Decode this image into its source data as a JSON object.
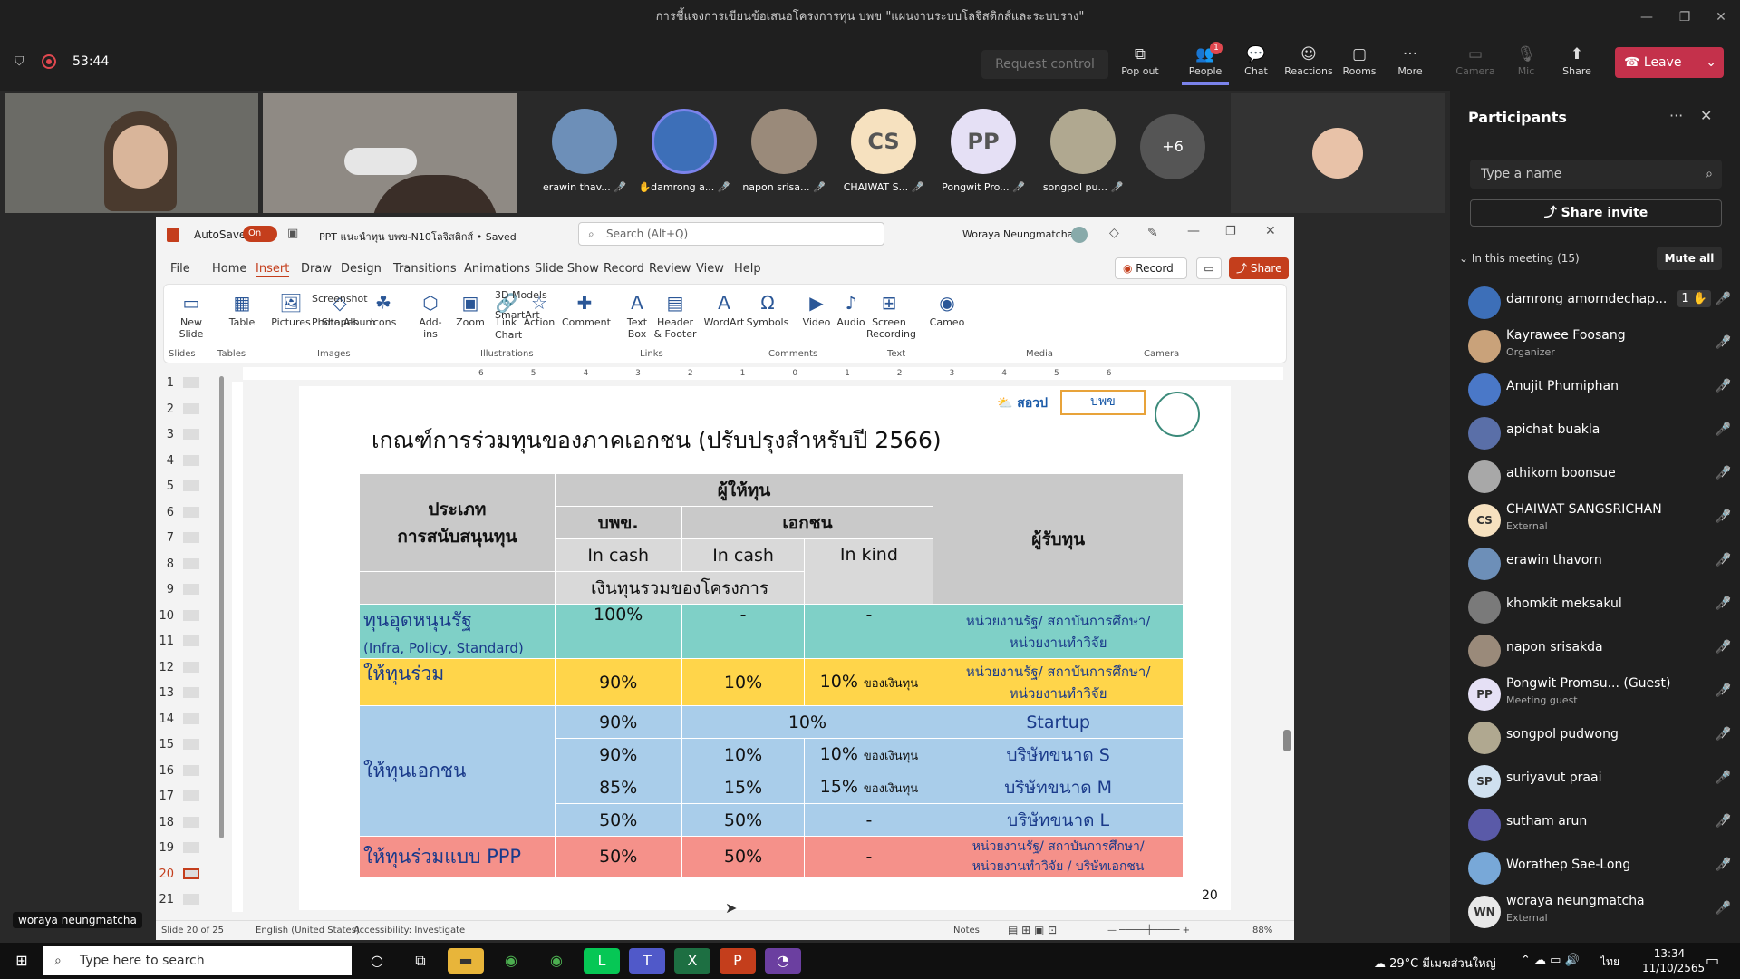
{
  "window": {
    "title": "การชี้แจงการเขียนข้อเสนอโครงการทุน บพข \"แผนงานระบบโลจิสติกส์และระบบราง\"",
    "min": "—",
    "max": "❐",
    "close": "✕"
  },
  "meeting": {
    "timer": "53:44",
    "request_control": "Request control",
    "buttons": [
      {
        "label": "Pop out",
        "icon": "popout-icon",
        "glyph": "⧉"
      },
      {
        "label": "People",
        "icon": "people-icon",
        "glyph": "👥",
        "badge": "1"
      },
      {
        "label": "Chat",
        "icon": "chat-icon",
        "glyph": "💬"
      },
      {
        "label": "Reactions",
        "icon": "reactions-icon",
        "glyph": "☺"
      },
      {
        "label": "Rooms",
        "icon": "rooms-icon",
        "glyph": "▢"
      },
      {
        "label": "More",
        "icon": "more-icon",
        "glyph": "···"
      }
    ],
    "camera": "Camera",
    "mic": "Mic",
    "share": "Share",
    "leave": "Leave"
  },
  "videos": {
    "presenter_label": "woraya neungmatcha",
    "avatars": [
      {
        "name": "erawin thav...",
        "initials": "",
        "color": "#6d8fb8"
      },
      {
        "name": "damrong a...",
        "initials": "",
        "color": "#3d6fb8",
        "hand": "✋"
      },
      {
        "name": "napon srisa...",
        "initials": "",
        "color": "#9a8a7a"
      },
      {
        "name": "CHAIWAT S...",
        "initials": "CS",
        "color": "#f6e1bf"
      },
      {
        "name": "Pongwit Pro...",
        "initials": "PP",
        "color": "#e5e0f5"
      },
      {
        "name": "songpol pu...",
        "initials": "",
        "color": "#b0a890"
      }
    ],
    "more_count": "+6"
  },
  "ppt": {
    "autosave": "AutoSave",
    "autosave_state": "On",
    "filename": "PPT แนะนำทุน บพข-N10โลจิสติกส์ • Saved",
    "search_placeholder": "Search (Alt+Q)",
    "user": "Woraya Neungmatcha",
    "record": "Record",
    "share": "Share",
    "tabs": [
      "File",
      "Home",
      "Insert",
      "Draw",
      "Design",
      "Transitions",
      "Animations",
      "Slide Show",
      "Record",
      "Review",
      "View",
      "Help"
    ],
    "ribbon": [
      {
        "label": "New\nSlide",
        "glyph": "▭"
      },
      {
        "label": "Table",
        "glyph": "▦"
      },
      {
        "label": "Pictures",
        "glyph": "🖼"
      },
      {
        "label": "Shapes",
        "glyph": "◇"
      },
      {
        "label": "Icons",
        "glyph": "☘"
      },
      {
        "label": "Add-\nins",
        "glyph": "⬡"
      },
      {
        "label": "Zoom",
        "glyph": "▣"
      },
      {
        "label": "Link",
        "glyph": "🔗"
      },
      {
        "label": "Action",
        "glyph": "☆"
      },
      {
        "label": "Comment",
        "glyph": "✚"
      },
      {
        "label": "Text\nBox",
        "glyph": "A"
      },
      {
        "label": "Header\n& Footer",
        "glyph": "▤"
      },
      {
        "label": "WordArt",
        "glyph": "A"
      },
      {
        "label": "Symbols",
        "glyph": "Ω"
      },
      {
        "label": "Video",
        "glyph": "▶"
      },
      {
        "label": "Audio",
        "glyph": "♪"
      },
      {
        "label": "Screen\nRecording",
        "glyph": "⊞"
      },
      {
        "label": "Cameo",
        "glyph": "◉"
      }
    ],
    "ribbon_small": [
      "Screenshot",
      "Photo Album",
      "3D Models",
      "SmartArt",
      "Chart"
    ],
    "groups": [
      "Slides",
      "Tables",
      "Images",
      "Illustrations",
      "Links",
      "Comments",
      "Text",
      "Media",
      "Camera"
    ],
    "status": {
      "slide": "Slide 20 of 25",
      "lang": "English (United States)",
      "access": "Accessibility: Investigate",
      "notes": "Notes",
      "zoom": "88%"
    },
    "thumbs": [
      "1",
      "2",
      "3",
      "4",
      "5",
      "6",
      "7",
      "8",
      "9",
      "10",
      "11",
      "12",
      "13",
      "14",
      "15",
      "16",
      "17",
      "18",
      "19",
      "20",
      "21"
    ]
  },
  "slide": {
    "title": "เกณฑ์การร่วมทุนของภาคเอกชน (ปรับปรุงสำหรับปี 2566)",
    "page": "20",
    "h_giver": "ผู้ให้ทุน",
    "h_type": "ประเภท\nการสนับสนุนทุน",
    "h_bpk": "บพข.",
    "h_private": "เอกชน",
    "h_receiver": "ผู้รับทุน",
    "h_cash1": "In cash",
    "h_cash2": "In cash",
    "h_kind": "In kind",
    "h_joint": "เงินทุนรวมของโครงการ",
    "r1": {
      "type": "ทุนอุดหนุนรัฐ",
      "sub": "(Infra, Policy, Standard)",
      "a": "100%",
      "b": "-",
      "c": "-",
      "d": "หน่วยงานรัฐ/ สถาบันการศึกษา/\nหน่วยงานทำวิจัย"
    },
    "r2": {
      "type": "ให้ทุนร่วม",
      "a": "90%",
      "b": "10%",
      "c": "10%",
      "c2": "ของเงินทุน",
      "d": "หน่วยงานรัฐ/ สถาบันการศึกษา/\nหน่วยงานทำวิจัย"
    },
    "r3": {
      "type": "ให้ทุนเอกชน",
      "rows": [
        {
          "a": "90%",
          "bc": "10%",
          "d": "Startup"
        },
        {
          "a": "90%",
          "b": "10%",
          "c": "10%",
          "c2": "ของเงินทุน",
          "d": "บริษัทขนาด S"
        },
        {
          "a": "85%",
          "b": "15%",
          "c": "15%",
          "c2": "ของเงินทุน",
          "d": "บริษัทขนาด M"
        },
        {
          "a": "50%",
          "b": "50%",
          "c": "-",
          "d": "บริษัทขนาด L"
        }
      ]
    },
    "r4": {
      "type": "ให้ทุนร่วมแบบ PPP",
      "a": "50%",
      "b": "50%",
      "c": "-",
      "d": "หน่วยงานรัฐ/ สถาบันการศึกษา/\nหน่วยงานทำวิจัย / บริษัทเอกชน"
    },
    "colors": {
      "teal": "#7fd0c7",
      "yellow": "#ffd54a",
      "blue": "#a9cdea",
      "red": "#f5918a",
      "gray": "#c9c9c9"
    }
  },
  "participants": {
    "title": "Participants",
    "search_placeholder": "Type a name",
    "share_invite": "Share invite",
    "in_meeting": "In this meeting (15)",
    "mute_all": "Mute all",
    "list": [
      {
        "name": "damrong amorndechap...",
        "sub": "",
        "ini": "",
        "c": "#3d6fb8",
        "hand": "1 ✋",
        "mic": "🎤"
      },
      {
        "name": "Kayrawee Foosang",
        "sub": "Organizer",
        "ini": "",
        "c": "#c9a27a",
        "mic": "🎤̸"
      },
      {
        "name": "Anujit Phumiphan",
        "sub": "",
        "ini": "",
        "c": "#4a78c8",
        "mic": "🎤̸"
      },
      {
        "name": "apichat buakla",
        "sub": "",
        "ini": "",
        "c": "#5a6fa8",
        "mic": "🎤"
      },
      {
        "name": "athikom boonsue",
        "sub": "",
        "ini": "",
        "c": "#a8a8a8",
        "mic": "🎤̸"
      },
      {
        "name": "CHAIWAT SANGSRICHAN",
        "sub": "External",
        "ini": "CS",
        "c": "#f6e1bf",
        "mic": "🎤̸"
      },
      {
        "name": "erawin thavorn",
        "sub": "",
        "ini": "",
        "c": "#6d8fb8",
        "mic": "🎤̸"
      },
      {
        "name": "khomkit meksakul",
        "sub": "",
        "ini": "",
        "c": "#7a7a7a",
        "mic": "🎤̸"
      },
      {
        "name": "napon srisakda",
        "sub": "",
        "ini": "",
        "c": "#9a8a7a",
        "mic": "🎤̸"
      },
      {
        "name": "Pongwit Promsu... (Guest)",
        "sub": "Meeting guest",
        "ini": "PP",
        "c": "#e5e0f5",
        "mic": "🎤̸"
      },
      {
        "name": "songpol pudwong",
        "sub": "",
        "ini": "",
        "c": "#b0a890",
        "mic": "🎤̸"
      },
      {
        "name": "suriyavut praai",
        "sub": "",
        "ini": "SP",
        "c": "#cfe0ef",
        "mic": "🎤"
      },
      {
        "name": "sutham arun",
        "sub": "",
        "ini": "",
        "c": "#5a5aa8",
        "mic": "🎤̸"
      },
      {
        "name": "Worathep Sae-Long",
        "sub": "",
        "ini": "",
        "c": "#78a8d8",
        "mic": "🎤̸"
      },
      {
        "name": "woraya neungmatcha",
        "sub": "External",
        "ini": "WN",
        "c": "#e8e8e8",
        "mic": "🎤"
      }
    ]
  },
  "taskbar": {
    "search": "Type here to search",
    "weather": "29°C มีเมฆส่วนใหญ่",
    "lang": "ไทย",
    "time": "13:34",
    "date": "11/10/2565"
  }
}
